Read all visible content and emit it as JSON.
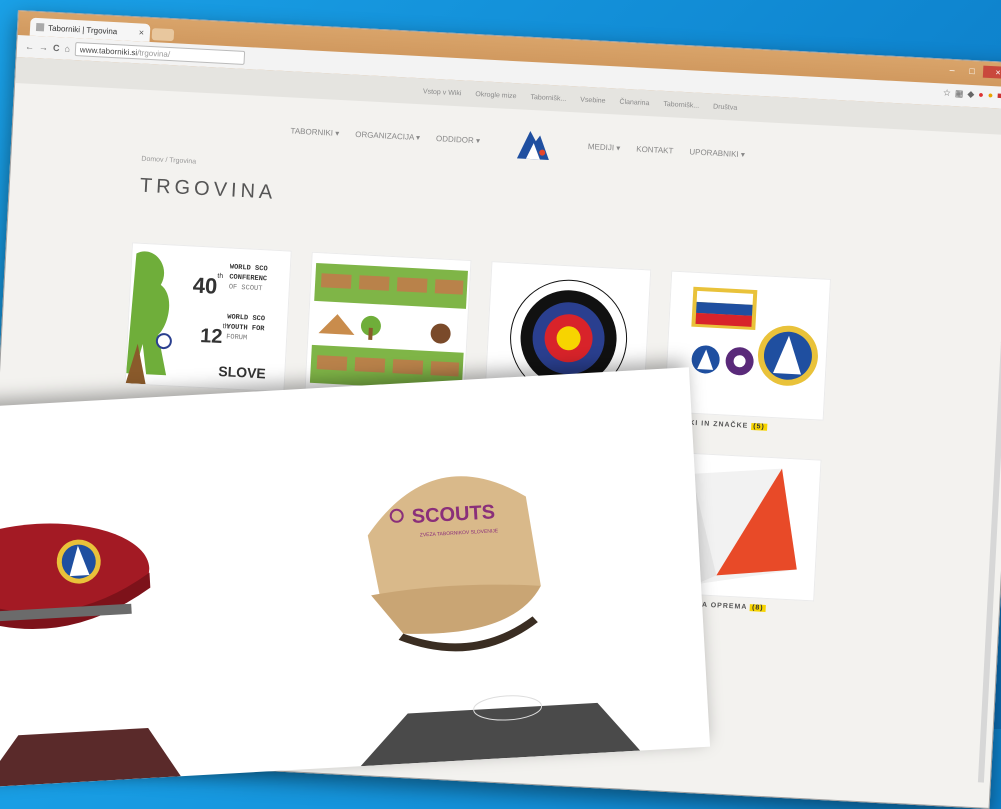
{
  "browser": {
    "tab_title": "Taborniki | Trgovina",
    "tab_close": "×",
    "url_host": "www.taborniki.si",
    "url_path": "/trgovina/",
    "nav_back": "←",
    "nav_forward": "→",
    "nav_reload": "C",
    "window_min": "–",
    "window_max": "□",
    "window_close": "×"
  },
  "site": {
    "top_links": [
      "Vstop v Wiki",
      "Okrogle mize",
      "Tabornišk...",
      "Vsebine",
      "Članarina",
      "Tabornišk...",
      "Društva"
    ],
    "menu_left": [
      "TABORNIKI ▾",
      "ORGANIZACIJA ▾",
      "ODDIDOR ▾"
    ],
    "menu_right": [
      "MEDIJI ▾",
      "KONTAKT",
      "UPORABNIKI ▾"
    ],
    "breadcrumb": "Domov / Trgovina",
    "page_title": "TRGOVINA",
    "products": [
      {
        "id": "poster",
        "caption": ""
      },
      {
        "id": "stamps",
        "caption": ""
      },
      {
        "id": "target",
        "caption": ""
      },
      {
        "id": "patches",
        "caption": "NAŠITKI IN ZNAČKE",
        "count": "(5)"
      },
      {
        "id": "empty1",
        "caption": ""
      },
      {
        "id": "empty2",
        "caption": ""
      },
      {
        "id": "empty3",
        "caption": ""
      },
      {
        "id": "orienteering",
        "caption": "ENTACIJSKA OPREMA",
        "count": "(8)"
      }
    ],
    "poster_text": {
      "num1": "40",
      "num1_sup": "th",
      "line1a": "WORLD SCO",
      "line1b": "CONFERENC",
      "line1c": "OF SCOUT",
      "num2": "12",
      "num2_sup": "th",
      "line2a": "WORLD SCO",
      "line2b": "YOUTH FOR",
      "line2c": "FORUM",
      "bottom": "SLOVE"
    },
    "cap_brand": "SCOUTS",
    "cap_subtitle": "ZVEZA TABORNIKOV SLOVENIJE"
  },
  "colors": {
    "accent_yellow": "#f7d400",
    "chrome_orange": "#d09a5f",
    "desktop_blue": "#1aa0e6"
  }
}
